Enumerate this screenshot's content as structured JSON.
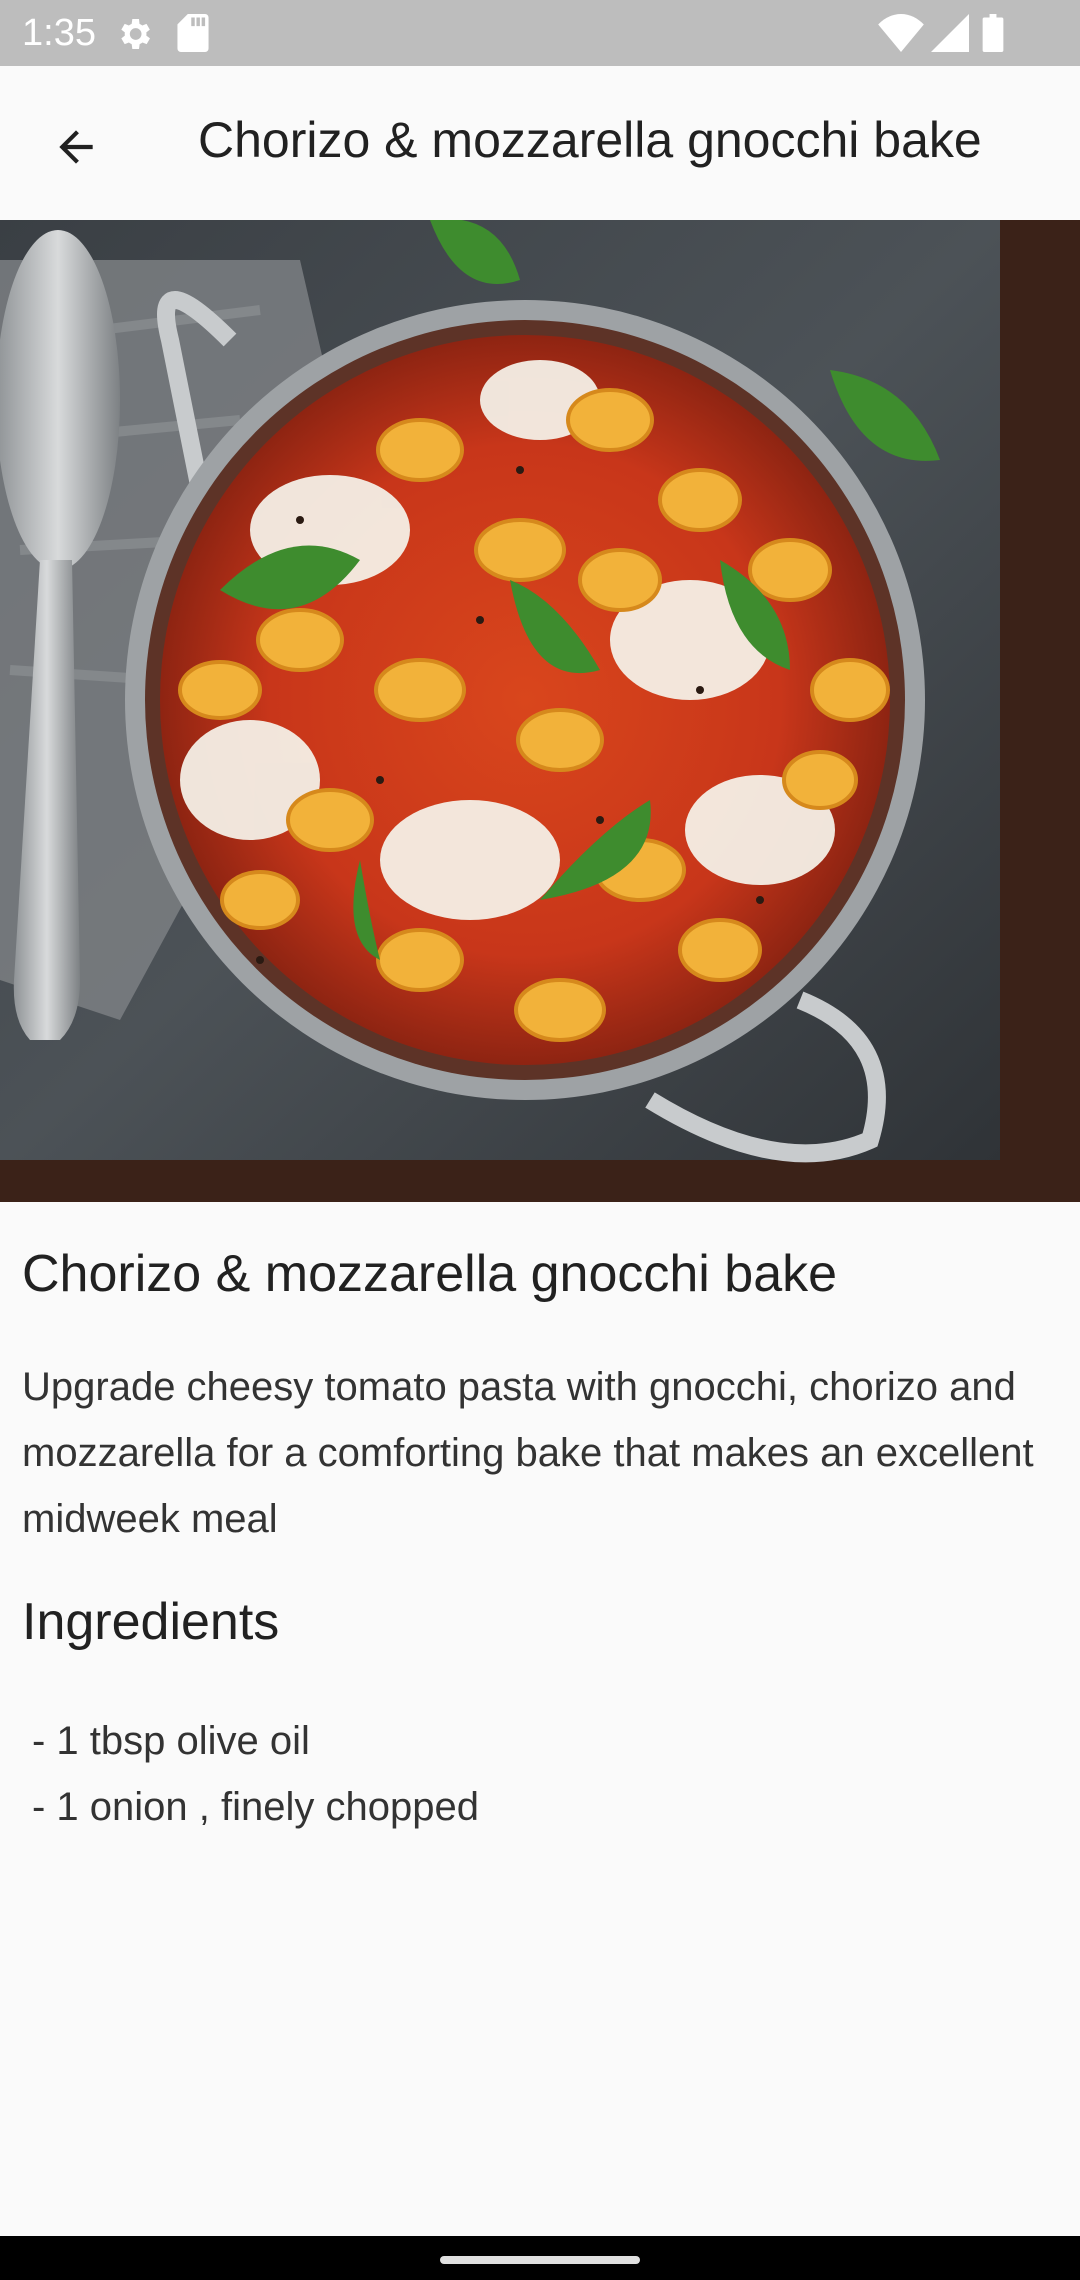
{
  "status_bar": {
    "time": "1:35",
    "icons": [
      "gear-icon",
      "sd-card-icon",
      "wifi-icon",
      "signal-icon",
      "battery-icon"
    ]
  },
  "app_bar": {
    "back_icon": "arrow-back-icon",
    "title": "Chorizo & mozzarella gnocchi bake"
  },
  "recipe": {
    "title": "Chorizo & mozzarella gnocchi bake",
    "description": "Upgrade cheesy tomato pasta with gnocchi, chorizo and mozzarella for a comforting bake that makes an excellent midweek meal",
    "ingredients_heading": "Ingredients",
    "ingredients": [
      " - 1 tbsp olive oil",
      " - 1 onion , finely chopped"
    ]
  },
  "colors": {
    "status_bar_bg": "#bdbdbd",
    "background": "#fafafa",
    "text_primary": "#212121",
    "nav_bar_bg": "#000000"
  }
}
